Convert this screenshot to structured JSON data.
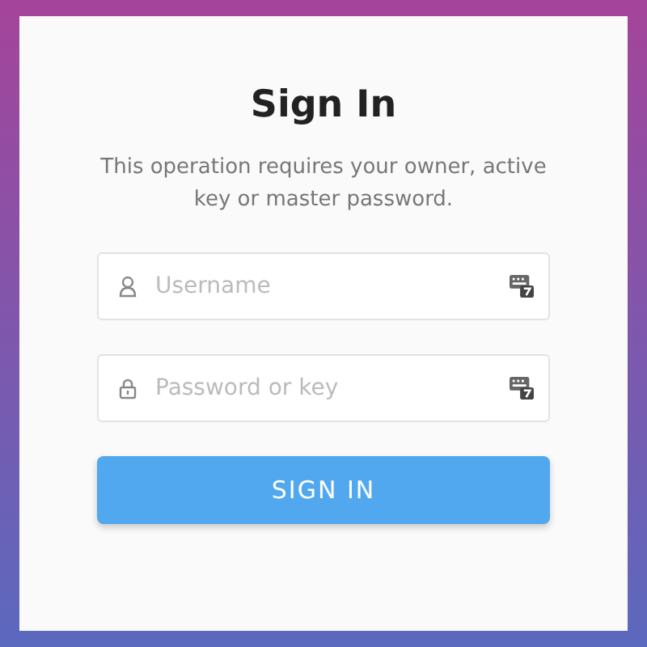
{
  "title": "Sign In",
  "description": "This operation requires your owner, active key or master password.",
  "fields": [
    {
      "kind": "user",
      "placeholder": "Username"
    },
    {
      "kind": "lock",
      "placeholder": "Password or key"
    }
  ],
  "button": "SIGN IN"
}
